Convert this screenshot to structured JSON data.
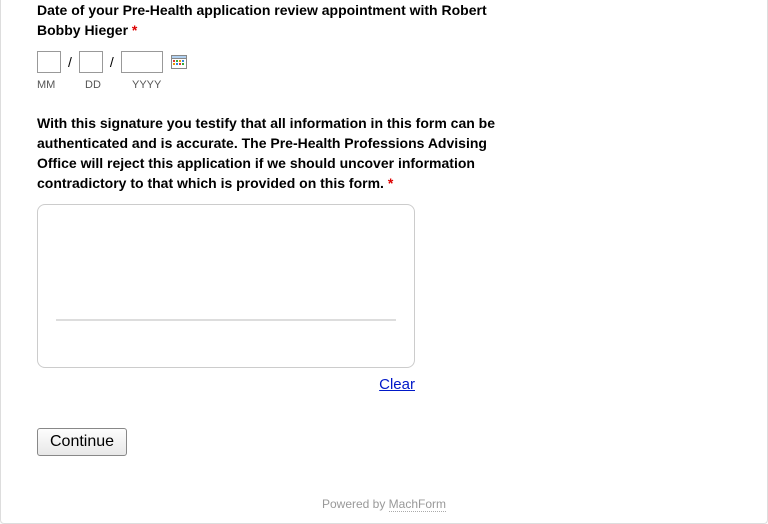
{
  "date_field": {
    "label": "Date of your Pre-Health application review appointment with Robert Bobby Hieger",
    "required_mark": "*",
    "mm": "",
    "dd": "",
    "yyyy": "",
    "slash": "/",
    "sub_mm": "MM",
    "sub_dd": "DD",
    "sub_yyyy": "YYYY"
  },
  "signature_field": {
    "label": "With this signature you testify that all information in this form can be authenticated and is accurate. The Pre-Health Professions Advising Office will reject this application if we should uncover information contradictory to that which is provided on this form.",
    "required_mark": "*",
    "clear_label": "Clear"
  },
  "continue_label": "Continue",
  "footer": {
    "prefix": "Powered by ",
    "link": "MachForm"
  }
}
